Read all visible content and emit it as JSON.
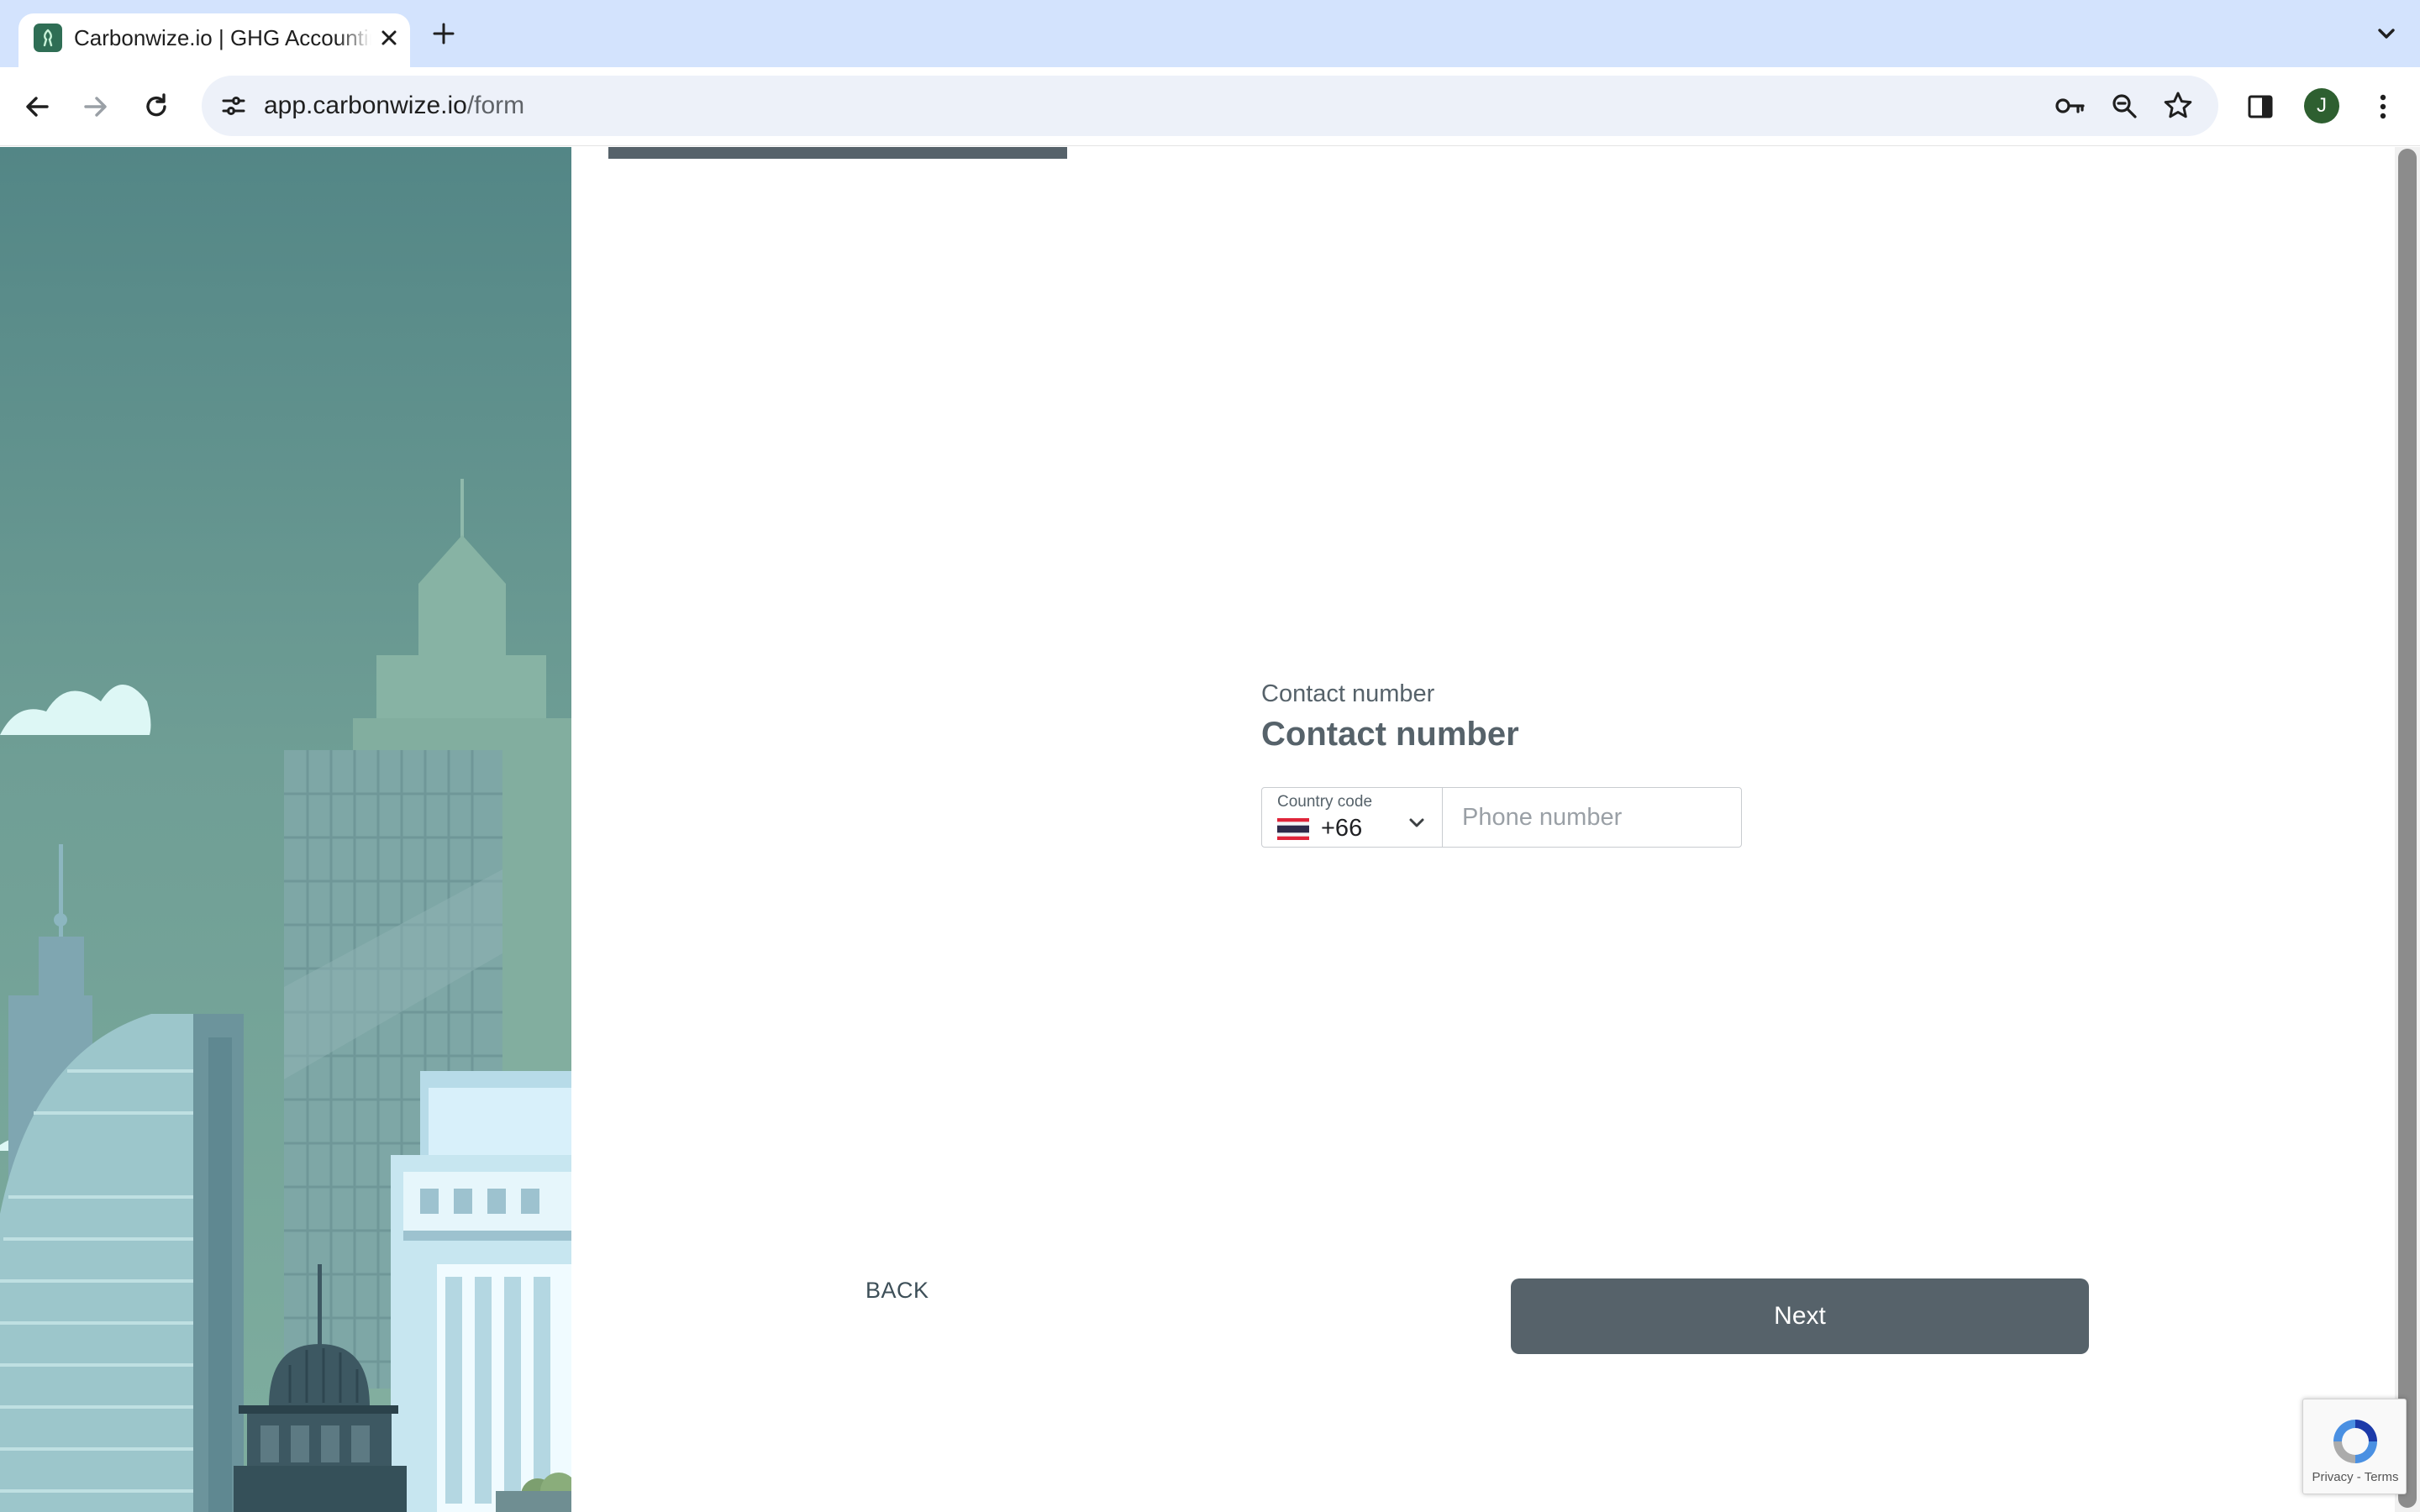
{
  "browser": {
    "tab_title": "Carbonwize.io | GHG Accounting",
    "url_host": "app.carbonwize.io",
    "url_path": "/form",
    "profile_initial": "J"
  },
  "form": {
    "progress": 0.26,
    "question_label": "Contact number",
    "question_title": "Contact number",
    "country_code_label": "Country code",
    "country_code_value": "+66",
    "country_flag": "thailand-flag",
    "phone_placeholder": "Phone number",
    "back_label": "BACK",
    "next_label": "Next"
  },
  "recaptcha": {
    "privacy": "Privacy",
    "separator": "-",
    "terms": "Terms"
  },
  "colors": {
    "tabbar": "#d3e3fd",
    "primary": "#56626a",
    "illustration_sky": "#5a8a8a"
  }
}
